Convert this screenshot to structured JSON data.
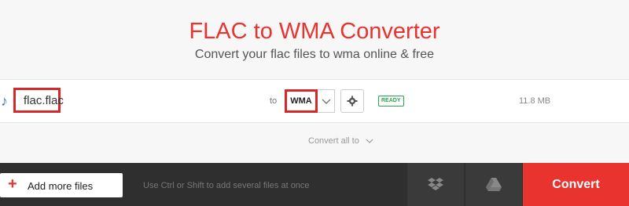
{
  "header": {
    "title": "FLAC to WMA Converter",
    "subtitle": "Convert your flac files to wma online & free"
  },
  "file": {
    "icon": "music-note-icon",
    "name": "flac.flac",
    "to_label": "to",
    "format": "WMA",
    "status": "READY",
    "size": "11.8 MB"
  },
  "convert_all": {
    "label": "Convert all to"
  },
  "bottom": {
    "add_label": "Add more files",
    "hint": "Use Ctrl or Shift to add several files at once",
    "convert_label": "Convert"
  },
  "colors": {
    "accent": "#e8332f",
    "highlight_border": "#d62828",
    "ready": "#2ea44f",
    "bar": "#2f2f2f"
  }
}
